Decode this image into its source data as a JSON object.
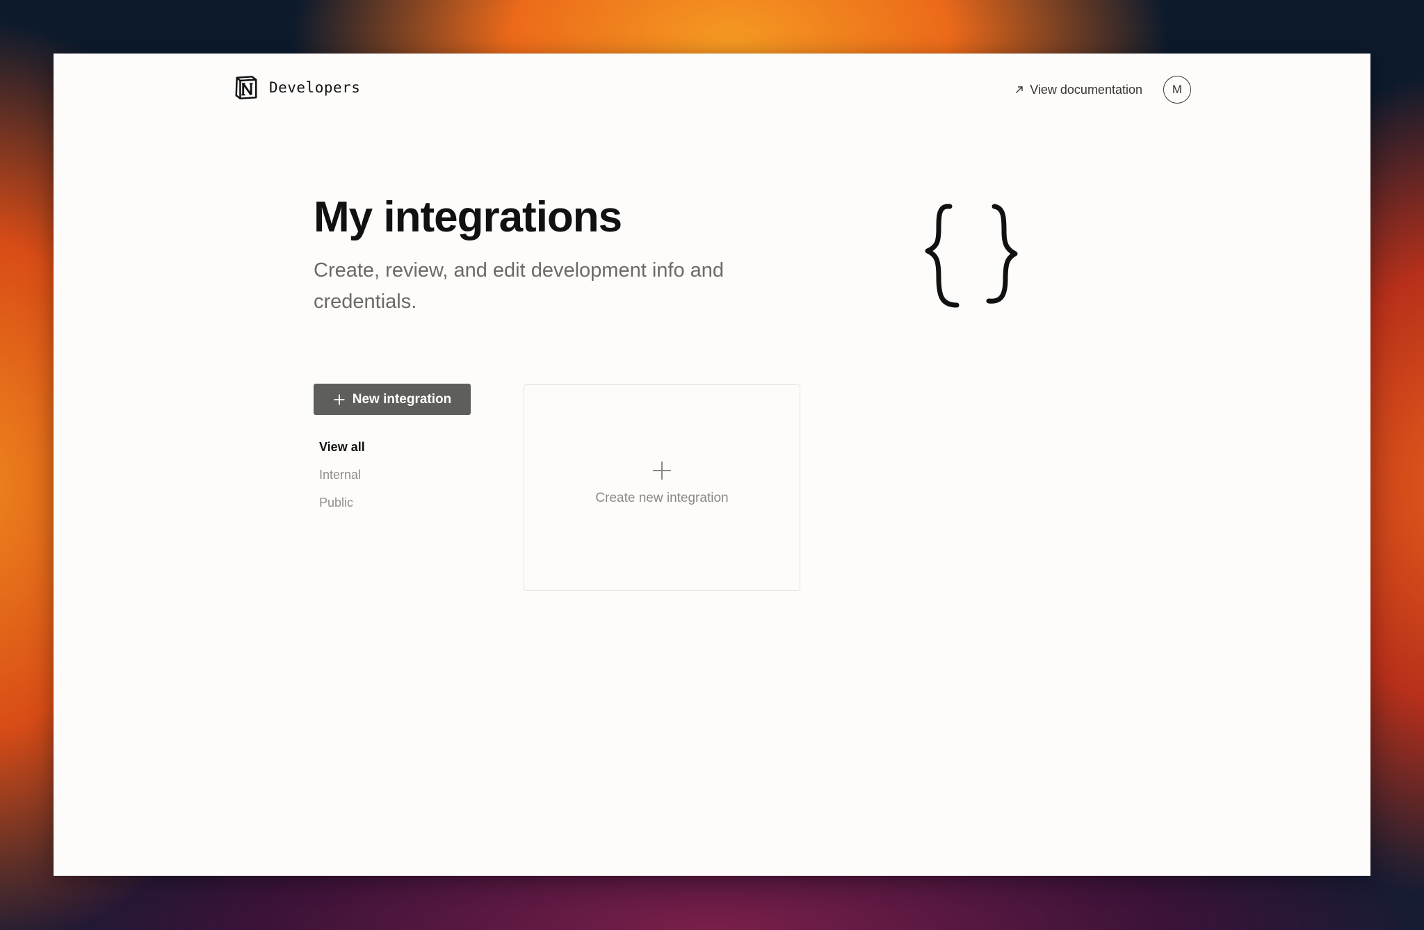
{
  "header": {
    "brand_text": "Developers",
    "doc_link_label": "View documentation",
    "avatar_initial": "M"
  },
  "hero": {
    "title": "My integrations",
    "subtitle": "Create, review, and edit development info and credentials."
  },
  "sidebar": {
    "new_button_label": "New integration",
    "filters": [
      {
        "label": "View all",
        "active": true
      },
      {
        "label": "Internal",
        "active": false
      },
      {
        "label": "Public",
        "active": false
      }
    ]
  },
  "card": {
    "create_label": "Create new integration"
  },
  "icons": {
    "brand": "notion-logo-icon",
    "doc_link": "arrow-up-right-icon",
    "hero": "curly-braces-icon",
    "new_button": "plus-icon",
    "card": "plus-icon"
  },
  "colors": {
    "button_bg": "#5e5e5c",
    "page_bg": "#fdfcfb",
    "muted_text": "#8f8e8a"
  }
}
